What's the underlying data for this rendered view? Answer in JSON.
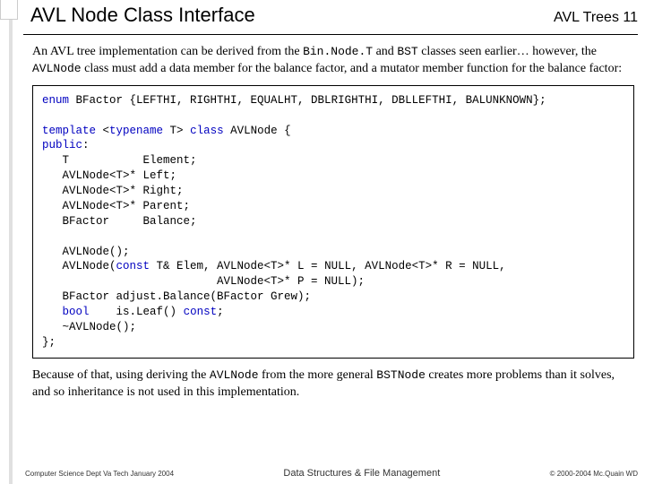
{
  "header": {
    "title": "AVL Node Class Interface",
    "section": "AVL Trees",
    "pageno": "11"
  },
  "para1_a": "An AVL tree implementation can be derived from the ",
  "para1_code1": "Bin.Node.T",
  "para1_b": " and ",
  "para1_code2": "BST",
  "para1_c": " classes seen earlier… however, the ",
  "para1_code3": "AVLNode",
  "para1_d": " class must add a data member for the balance factor, and a mutator member function for the balance factor:",
  "code": {
    "l1a": "enum",
    "l1b": " BFactor {LEFTHI, RIGHTHI, EQUALHT, DBLRIGHTHI, DBLLEFTHI, BALUNKNOWN};",
    "blank1": "",
    "l2a": "template",
    "l2b": " <",
    "l2c": "typename",
    "l2d": " T> ",
    "l2e": "class",
    "l2f": " AVLNode {",
    "l3a": "public",
    "l3b": ":",
    "l4": "   T           Element;",
    "l5": "   AVLNode<T>* Left;",
    "l6": "   AVLNode<T>* Right;",
    "l7": "   AVLNode<T>* Parent;",
    "l8": "   BFactor     Balance;",
    "blank2": "",
    "l9": "   AVLNode();",
    "l10a": "   AVLNode(",
    "l10b": "const",
    "l10c": " T& Elem, AVLNode<T>* L = NULL, AVLNode<T>* R = NULL,",
    "l11": "                          AVLNode<T>* P = NULL);",
    "l12": "   BFactor adjust.Balance(BFactor Grew);",
    "l13a": "   ",
    "l13b": "bool",
    "l13c": "    is.Leaf() ",
    "l13d": "const",
    "l13e": ";",
    "l14": "   ~AVLNode();",
    "l15": "};"
  },
  "para2_a": "Because of that, using deriving the ",
  "para2_code1": "AVLNode",
  "para2_b": " from the more general ",
  "para2_code2": "BSTNode",
  "para2_c": " creates more problems than it solves, and so inheritance is not used in this implementation.",
  "footer": {
    "left": "Computer Science Dept Va Tech January 2004",
    "mid": "Data Structures & File Management",
    "right": "© 2000-2004 Mc.Quain WD"
  }
}
